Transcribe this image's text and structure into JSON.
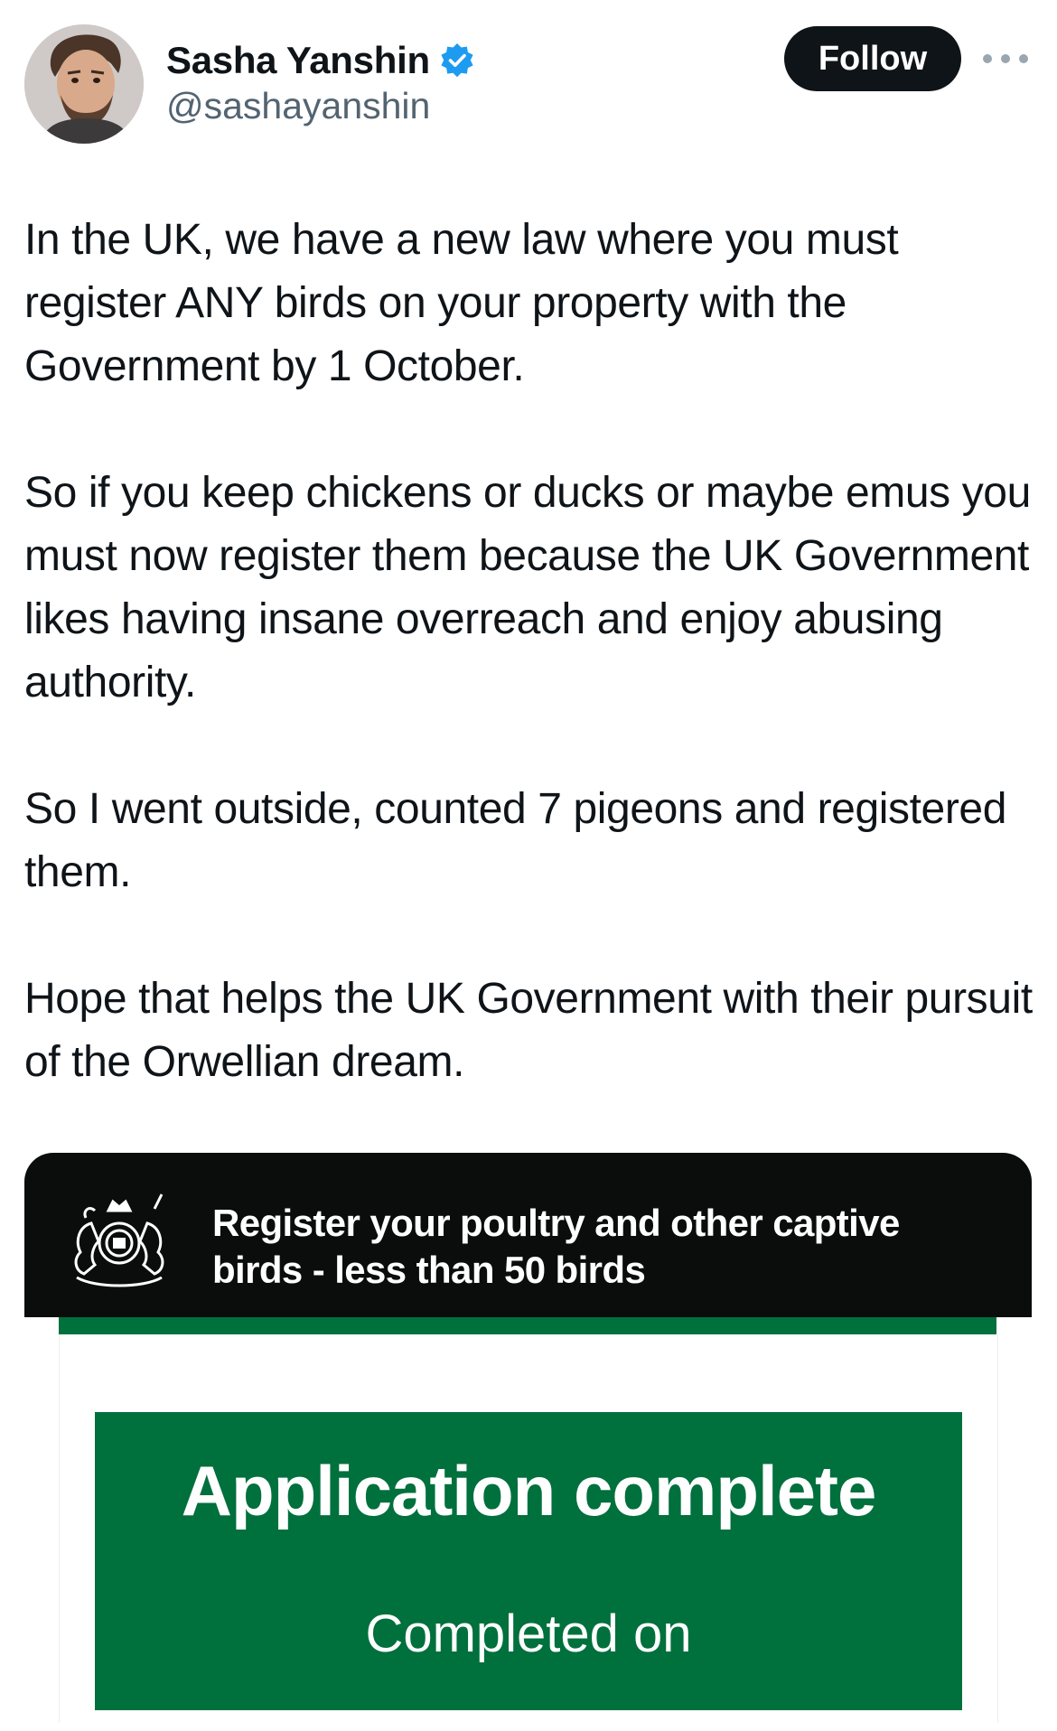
{
  "author": {
    "display_name": "Sasha Yanshin",
    "handle": "@sashayanshin",
    "verified": true,
    "avatar_icon": "user-avatar-photo"
  },
  "actions": {
    "follow_label": "Follow",
    "more_icon": "more-options-icon"
  },
  "tweet": {
    "paragraphs": [
      "In the UK, we have a new law where you must register ANY birds on your property with the Government by 1 October.",
      "So if you keep chickens or ducks or maybe emus you must now register them because the UK Government likes having insane overreach and enjoy abusing authority.",
      "So I went outside, counted 7 pigeons and registered them.",
      "Hope that helps the UK Government with their pursuit of the Orwellian dream."
    ]
  },
  "media": {
    "service_title": "Register your poultry and other captive birds - less than 50 birds",
    "crest_icon": "royal-coat-of-arms-icon",
    "panel_title": "Application complete",
    "panel_subtitle": "Completed on"
  },
  "colors": {
    "verified_blue": "#1d9bf0",
    "follow_bg": "#0f1419",
    "gov_black": "#0b0c0c",
    "gov_green": "#00703c",
    "handle_gray": "#536471"
  }
}
